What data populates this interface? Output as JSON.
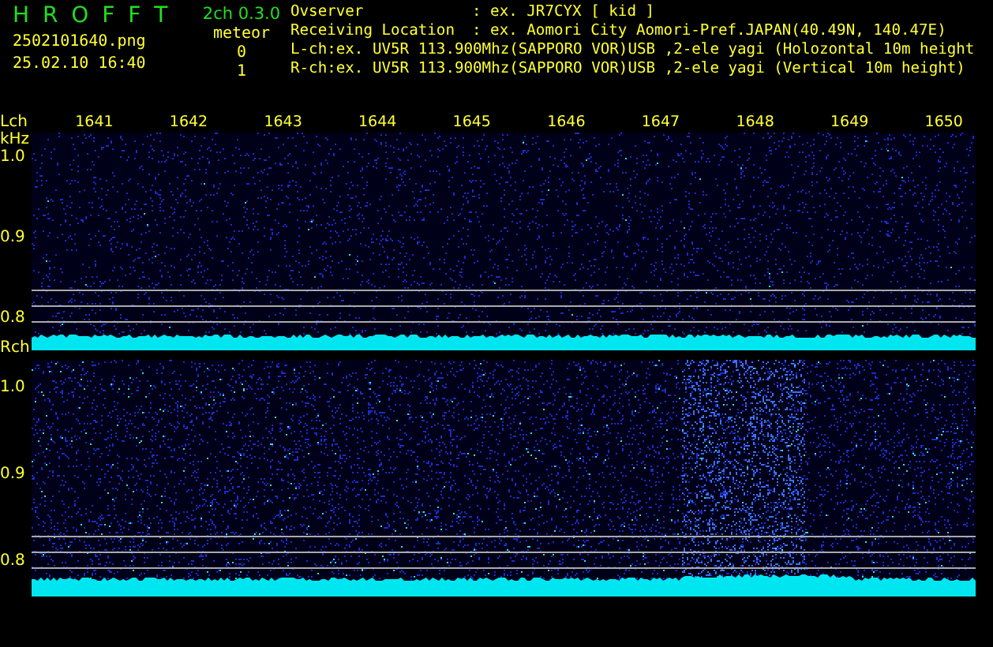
{
  "app": {
    "title": "H R O F F T",
    "version": "2ch 0.3.0",
    "filename": "2502101640.png",
    "datetime": "25.02.10 16:40"
  },
  "meteor": {
    "label": "meteor",
    "counts": [
      "0",
      "1"
    ]
  },
  "info": [
    {
      "label": "Ovserver",
      "value": ": ex. JR7CYX [ kid ]"
    },
    {
      "label": "Receiving Location",
      "value": ": ex. Aomori City Aomori-Pref.JAPAN(40.49N, 140.47E)"
    }
  ],
  "channel_lines": [
    "L-ch:ex. UV5R 113.900Mhz(SAPPORO VOR)USB ,2-ele yagi (Holozontal 10m height",
    "R-ch:ex. UV5R 113.900Mhz(SAPPORO VOR)USB ,2-ele yagi (Vertical 10m height)"
  ],
  "freq_axis": [
    "1641",
    "1642",
    "1643",
    "1644",
    "1645",
    "1646",
    "1647",
    "1648",
    "1649",
    "1650"
  ],
  "channels": [
    {
      "name": "Lch",
      "unit": "kHz",
      "yticks": [
        "1.0",
        "0.9",
        "0.8"
      ]
    },
    {
      "name": "Rch",
      "yticks": [
        "1.0",
        "0.9",
        "0.8"
      ]
    }
  ]
}
